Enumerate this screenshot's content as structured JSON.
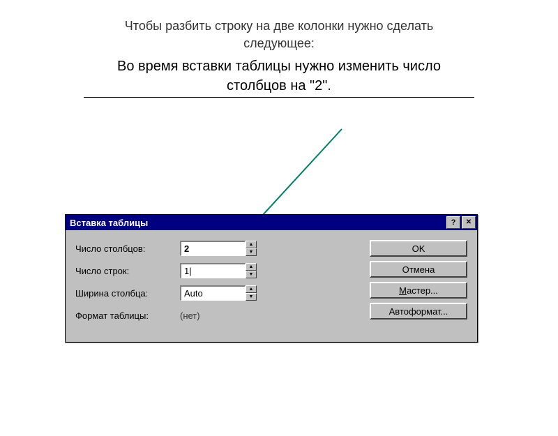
{
  "slide": {
    "heading_line1": "Чтобы разбить строку на две колонки нужно сделать",
    "heading_line2": "следующее:",
    "sub_line1": "Во время вставки таблицы нужно изменить число",
    "sub_line2": "столбцов на \"2\"."
  },
  "dialog": {
    "title": "Вставка таблицы",
    "help_glyph": "?",
    "close_glyph": "✕",
    "fields": {
      "columns_label": "Число столбцов:",
      "columns_value": "2",
      "rows_label": "Число строк:",
      "rows_value": "1|",
      "width_label": "Ширина столбца:",
      "width_value": "Auto",
      "format_label": "Формат таблицы:",
      "format_value": "(нет)"
    },
    "buttons": {
      "ok": "OK",
      "cancel": "Отмена",
      "wizard": "Мастер...",
      "autoformat": "Автоформат..."
    },
    "spin_up": "▲",
    "spin_down": "▼"
  }
}
